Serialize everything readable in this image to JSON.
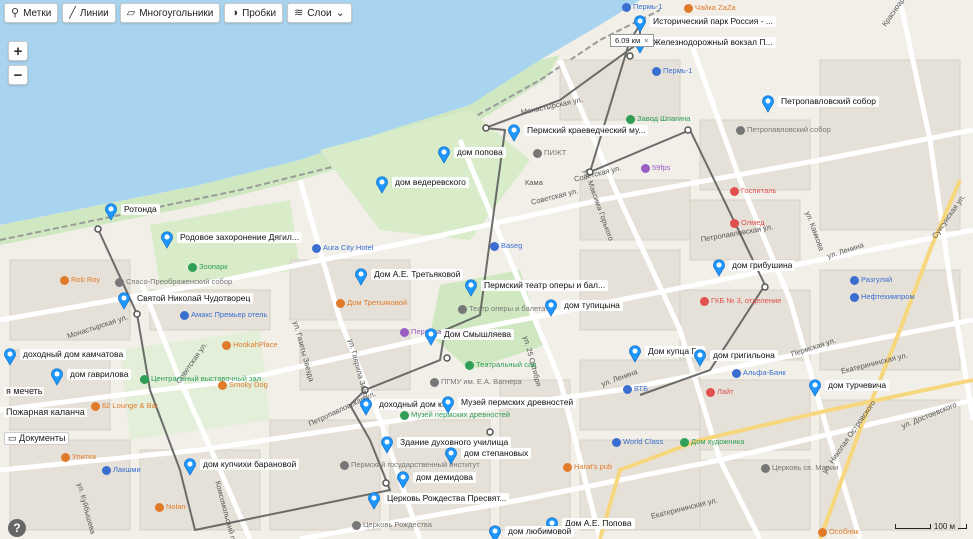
{
  "toolbar": {
    "marks_label": "Метки",
    "lines_label": "Линии",
    "polygons_label": "Многоугольники",
    "traffic_label": "Пробки",
    "layers_label": "Слои"
  },
  "zoom": {
    "in_label": "+",
    "out_label": "−"
  },
  "ruler": {
    "distance": "6.09 км",
    "close": "×"
  },
  "scale": {
    "label": "100 м"
  },
  "help": {
    "label": "?"
  },
  "pins": [
    {
      "label": "Исторический парк Россия - ..."
    },
    {
      "label": "Железнодорожный вокзал П..."
    },
    {
      "label": "Петропавловский собор"
    },
    {
      "label": "Пермский краеведческий му..."
    },
    {
      "label": "дом попова"
    },
    {
      "label": "дом ведеревского"
    },
    {
      "label": "Ротонда"
    },
    {
      "label": "Родовое захоронение Дягил..."
    },
    {
      "label": "Дом А.Е. Третьякoвой"
    },
    {
      "label": "Пермский театр оперы и бал..."
    },
    {
      "label": "Святой Николай Чудотворец"
    },
    {
      "label": "дом тупицына"
    },
    {
      "label": "дом грибушина"
    },
    {
      "label": "Дом Смышляева"
    },
    {
      "label": "Дом купца Г..."
    },
    {
      "label": "дом григильона"
    },
    {
      "label": "доходный дом камчатова"
    },
    {
      "label": "дом гаврилова"
    },
    {
      "label": "дом турчевича"
    },
    {
      "label": "доходный дом к..."
    },
    {
      "label": "Музей пермских древностей"
    },
    {
      "label": "Здание духовного училища"
    },
    {
      "label": "дом степановых"
    },
    {
      "label": "дом купчихи барановой"
    },
    {
      "label": "дом демидова"
    },
    {
      "label": "Церковь Рождества Пресвят..."
    },
    {
      "label": "Дом А.Е. Попова"
    },
    {
      "label": "дом любимовой"
    }
  ],
  "plain_labels": {
    "mosque": "я мечеть",
    "fire_tower": "Пожарная каланча",
    "documents": "Документы"
  },
  "pois": [
    {
      "label": "Чайка ZaZa",
      "color": "#e07b2a"
    },
    {
      "label": "Пермь-1",
      "color": "#3a6fd1"
    },
    {
      "label": "Пермь-1",
      "color": "#3a6fd1"
    },
    {
      "label": "Завод Шпагина",
      "color": "#2f9e57"
    },
    {
      "label": "Петропавловский собор",
      "color": "#777777"
    },
    {
      "label": "ПИЖТ",
      "color": "#777777"
    },
    {
      "label": "59fps",
      "color": "#9b5cc4"
    },
    {
      "label": "Госпиталь",
      "color": "#e05050"
    },
    {
      "label": "Олмед",
      "color": "#e05050"
    },
    {
      "label": "Aura City Hotel",
      "color": "#3a6fd1"
    },
    {
      "label": "Baseg",
      "color": "#3a6fd1"
    },
    {
      "label": "Зоопарк",
      "color": "#2f9e57"
    },
    {
      "label": "Rob Roy",
      "color": "#e07b2a"
    },
    {
      "label": "Дом Третьяковой",
      "color": "#e07b2a"
    },
    {
      "label": "Амакс Премьер отель",
      "color": "#3a6fd1"
    },
    {
      "label": "HookahPlace",
      "color": "#e07b2a"
    },
    {
      "label": "Центральный выставочный зал",
      "color": "#2f9e57"
    },
    {
      "label": "Smoky Dog",
      "color": "#e07b2a"
    },
    {
      "label": "62 Lounge & Bar",
      "color": "#e07b2a"
    },
    {
      "label": "Театр оперы и балета",
      "color": "#777777"
    },
    {
      "label": "Пермская филармония",
      "color": "#9b5cc4"
    },
    {
      "label": "Театральный сад",
      "color": "#2f9e57"
    },
    {
      "label": "ГКБ № 3, отделение",
      "color": "#e05050"
    },
    {
      "label": "Разгуляй",
      "color": "#3a6fd1"
    },
    {
      "label": "Нефтехимпром",
      "color": "#3a6fd1"
    },
    {
      "label": "Альфа-Банк",
      "color": "#3a6fd1"
    },
    {
      "label": "ВТБ",
      "color": "#3a6fd1"
    },
    {
      "label": "Лайт",
      "color": "#e05050"
    },
    {
      "label": "World Class",
      "color": "#3a6fd1"
    },
    {
      "label": "Дом художника",
      "color": "#2f9e57"
    },
    {
      "label": "Улитка",
      "color": "#e07b2a"
    },
    {
      "label": "Лакшми",
      "color": "#3a6fd1"
    },
    {
      "label": "Harat's pub",
      "color": "#e07b2a"
    },
    {
      "label": "Nolan",
      "color": "#e07b2a"
    },
    {
      "label": "Церковь св. Марии",
      "color": "#777777"
    },
    {
      "label": "Особняк",
      "color": "#e07b2a"
    },
    {
      "label": "Пермский государственный институт",
      "color": "#777777"
    },
    {
      "label": "ПГМУ им. Е.А. Вагнера",
      "color": "#777777"
    },
    {
      "label": "Музей пермских древностей",
      "color": "#2f9e57"
    },
    {
      "label": "Церковь Рождества",
      "color": "#777777"
    },
    {
      "label": "Спасо-Преображенский собор",
      "color": "#777777"
    }
  ],
  "streets": [
    {
      "label": "Советская ул."
    },
    {
      "label": "Советская ул."
    },
    {
      "label": "Советская ул."
    },
    {
      "label": "ул. Максима Горького"
    },
    {
      "label": "ул. Ленина"
    },
    {
      "label": "ул. Ленина"
    },
    {
      "label": "Петропавловская ул."
    },
    {
      "label": "Петропавловская ул."
    },
    {
      "label": "Монастырская ул."
    },
    {
      "label": "Монастырская ул."
    },
    {
      "label": "Екатерининская ул."
    },
    {
      "label": "Екатерининская ул."
    },
    {
      "label": "ул. Достоевского"
    },
    {
      "label": "ул. Николая Островского"
    },
    {
      "label": "Комсомольский просп."
    },
    {
      "label": "ул. 25 Октября"
    },
    {
      "label": "ул. Гаврила Заводя"
    },
    {
      "label": "ул. Газеты Звезда"
    },
    {
      "label": "ул. Куйбышева"
    },
    {
      "label": "Красноармейская ул."
    },
    {
      "label": "Сукcунская ул."
    },
    {
      "label": "ул. Камкова"
    },
    {
      "label": "Пермская ул."
    },
    {
      "label": "Кама"
    }
  ]
}
